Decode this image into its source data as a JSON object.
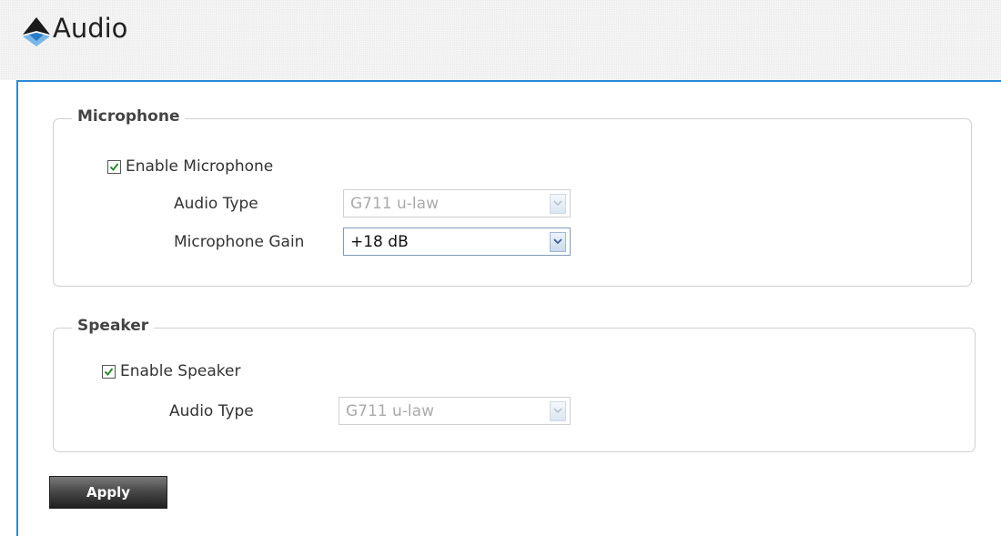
{
  "header": {
    "title": "Audio",
    "logo_icon": "brand-logo-icon"
  },
  "microphone": {
    "legend": "Microphone",
    "enable_label": "Enable Microphone",
    "enabled": true,
    "audio_type_label": "Audio Type",
    "audio_type_value": "G711 u-law",
    "gain_label": "Microphone Gain",
    "gain_value": "+18 dB"
  },
  "speaker": {
    "legend": "Speaker",
    "enable_label": "Enable Speaker",
    "enabled": true,
    "audio_type_label": "Audio Type",
    "audio_type_value": "G711 u-law"
  },
  "actions": {
    "apply_label": "Apply"
  },
  "colors": {
    "accent_border": "#2a8ad8",
    "check_green": "#2e8b2e"
  }
}
